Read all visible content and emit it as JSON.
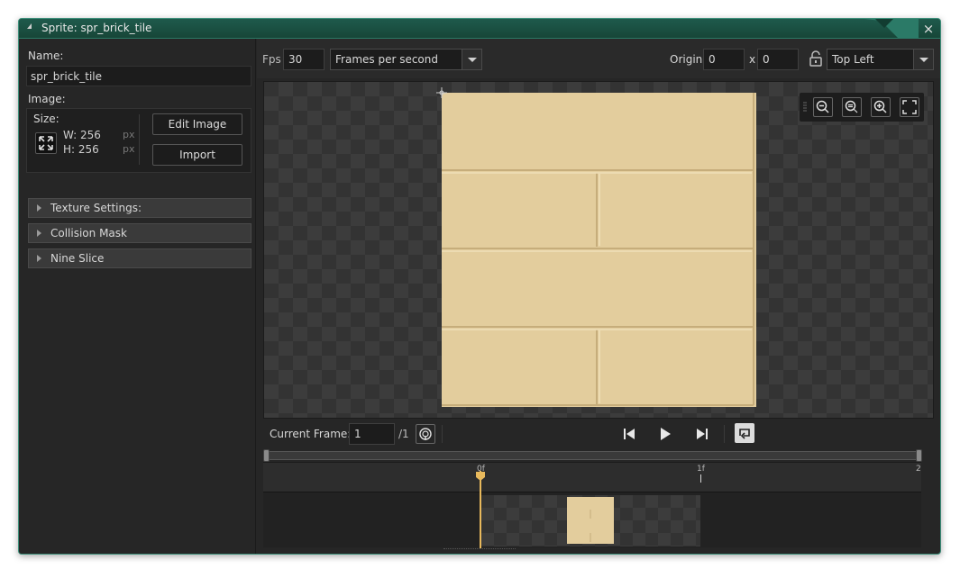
{
  "window": {
    "title": "Sprite: spr_brick_tile",
    "close_icon": "×"
  },
  "left_panel": {
    "name_label": "Name:",
    "name_value": "spr_brick_tile",
    "image_label": "Image:",
    "size_label": "Size:",
    "width_text": "W: 256",
    "height_text": "H: 256",
    "unit": "px",
    "edit_image_label": "Edit Image",
    "import_label": "Import",
    "sections": [
      "Texture Settings:",
      "Collision Mask",
      "Nine Slice"
    ]
  },
  "toolbar": {
    "fps_label": "Fps",
    "fps_value": "30",
    "speed_mode": "Frames per second",
    "origin_label": "Origin",
    "origin_x": "0",
    "origin_sep": "x",
    "origin_y": "0",
    "origin_preset": "Top Left"
  },
  "playback": {
    "current_frame_label": "Current Frame:",
    "current_frame": "1",
    "total_frames": "/1"
  },
  "timeline": {
    "ticks": [
      "0f",
      "1f",
      "2"
    ],
    "playhead_frame": 0
  },
  "colors": {
    "accent": "#2c7a66",
    "sprite_fill": "#e3cd9d",
    "sprite_line": "#c6ad7b",
    "playhead": "#e8b95c"
  }
}
